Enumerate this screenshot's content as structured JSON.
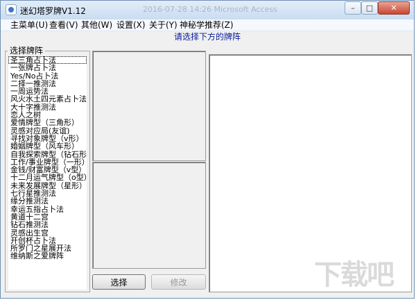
{
  "window": {
    "title": "迷幻塔罗牌V1.12",
    "ghost_text": "2016-07-28 14:26   Microsoft Access"
  },
  "caption": {
    "min": "–",
    "max": "□",
    "close": "✕"
  },
  "menu": [
    "主菜单(U)",
    "查看(V)",
    "其他(W)",
    "设置(X)",
    "关于(Y)",
    "神秘学推荐(Z)"
  ],
  "prompt": "请选择下方的牌阵",
  "group_label": "选择牌阵",
  "spreads": [
    "圣三角占卜法",
    "一张牌占卜法",
    "Yes/No占卜法",
    "二择一推测法",
    "一周运势法",
    "风火水土四元素占卜法",
    "大十字推测法",
    "恋人之树",
    "爱情牌型（三角形）",
    "灵感对应局(友谊)",
    "寻找对象牌型（v形）",
    "婚姻牌型（风车形）",
    "自我探索牌型（钻石形）",
    "工作/事业牌型（一形）",
    "金钱/财富牌型（v型）",
    "十二月运气牌型（o型）",
    "未来发展牌型（星形）",
    "七行星推测法",
    "缘分推测法",
    "幸运五指占卜法",
    "黄道十二宫",
    "钻石推测法",
    "灵感出生宫",
    "开创杯占卜法",
    "所罗门之星展开法",
    "维纳斯之爱牌阵"
  ],
  "buttons": {
    "select": "选择",
    "modify": "修改"
  },
  "watermark": "下载吧"
}
